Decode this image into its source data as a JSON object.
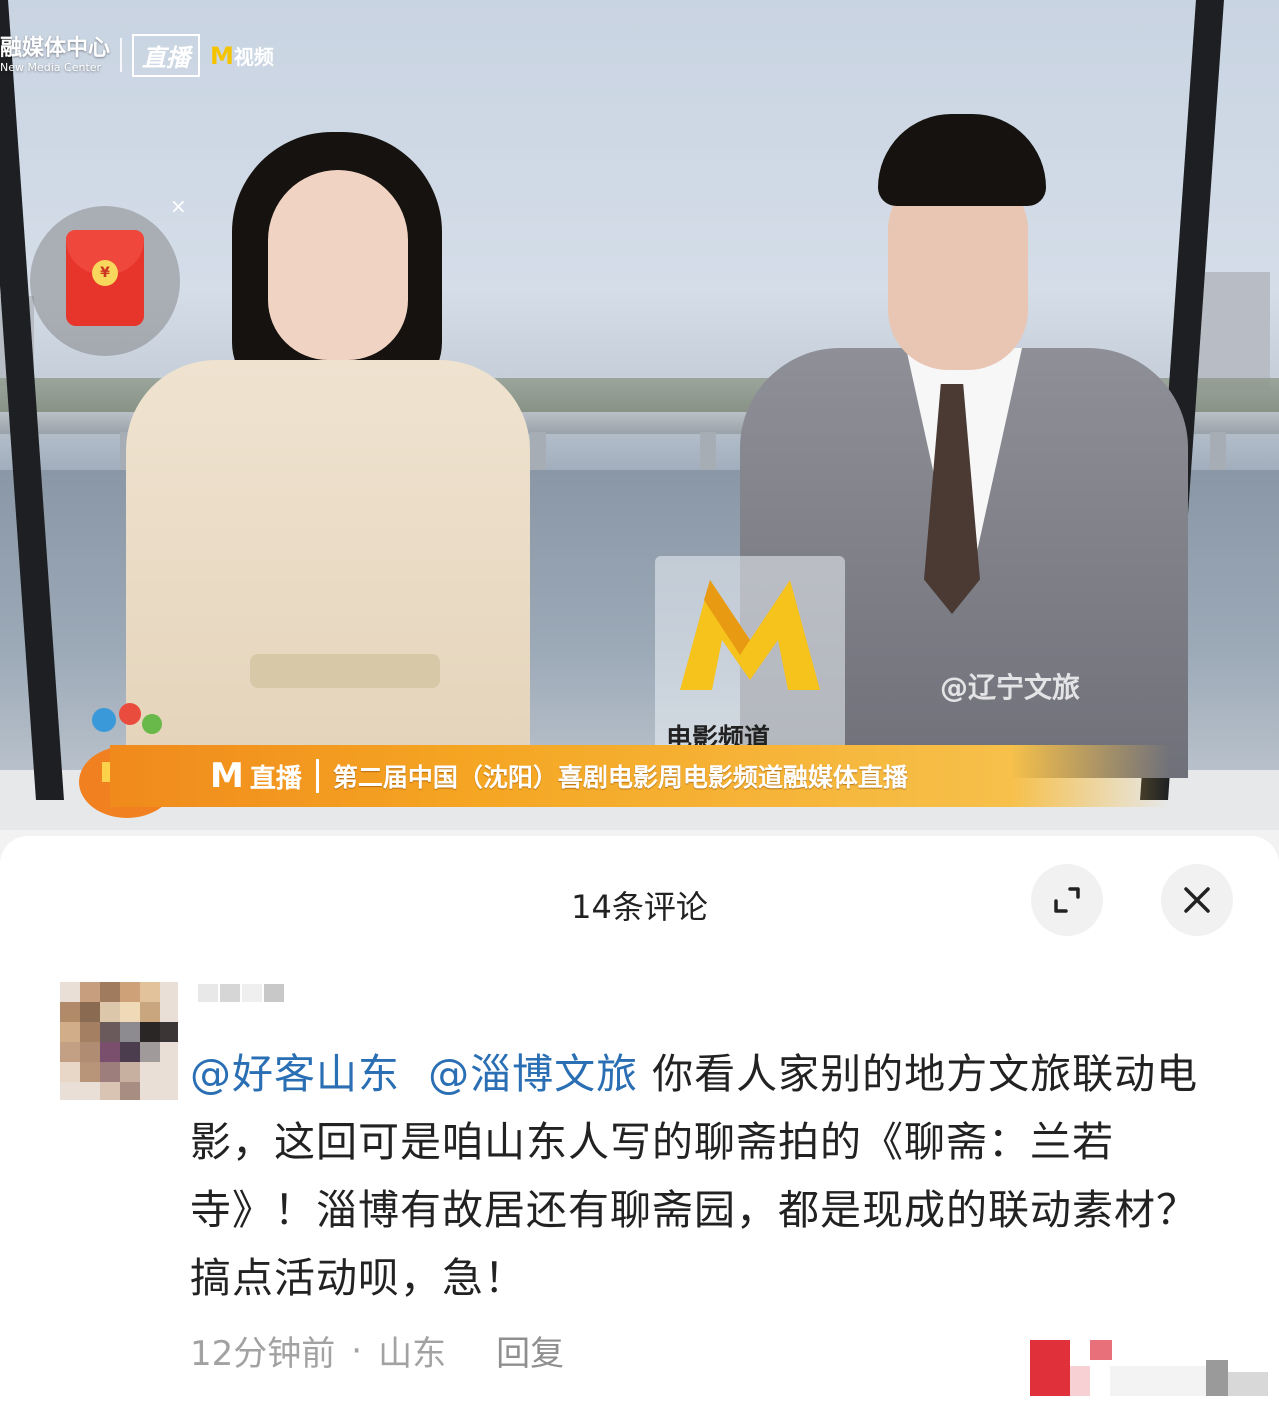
{
  "video": {
    "center_logo_cn": "融媒体中心",
    "center_logo_en": "New Media Center",
    "live_tag": "直播",
    "brand_m": "M",
    "brand_text": "视频",
    "podium_text": "电影频道",
    "watermark": "@辽宁文旅",
    "ticker": {
      "logo": "M",
      "live": "直播",
      "title": "第二届中国（沈阳）喜剧电影周电影频道融媒体直播"
    },
    "redpacket_close": "×",
    "redpacket_symbol": "¥"
  },
  "comments": {
    "title": "14条评论",
    "expand_icon": "expand-icon",
    "close_icon": "close-icon",
    "items": [
      {
        "mention1": "@好客山东",
        "mention2": "@淄博文旅",
        "text": "你看人家别的地方文旅联动电影，这回可是咱山东人写的聊斋拍的《聊斋：兰若寺》！淄博有故居还有聊斋园，都是现成的联动素材？搞点活动呗，急！",
        "time": "12分钟前",
        "sep": "·",
        "location": "山东",
        "reply": "回复"
      }
    ]
  }
}
